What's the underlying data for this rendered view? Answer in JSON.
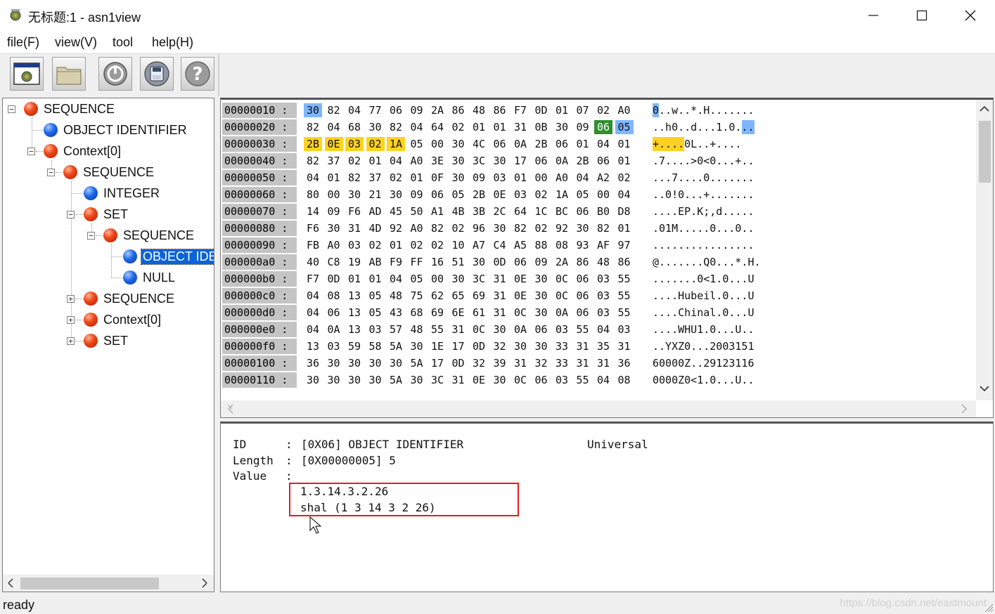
{
  "window": {
    "title": "无标题:1 - asn1view"
  },
  "menu": [
    "file(F)",
    "view(V)",
    "tool",
    "help(H)"
  ],
  "toolbar": {
    "buttons": [
      "app-icon",
      "folder-icon",
      "power-icon",
      "disk-icon",
      "help-icon"
    ]
  },
  "tree": {
    "nodes": [
      {
        "label": "SEQUENCE",
        "color": "red"
      },
      {
        "label": "OBJECT IDENTIFIER",
        "color": "blue"
      },
      {
        "label": "Context[0]",
        "color": "red"
      },
      {
        "label": "SEQUENCE",
        "color": "red"
      },
      {
        "label": "INTEGER",
        "color": "blue"
      },
      {
        "label": "SET",
        "color": "red"
      },
      {
        "label": "SEQUENCE",
        "color": "red"
      },
      {
        "label": "OBJECT IDENTIFIER",
        "color": "blue",
        "selected": true
      },
      {
        "label": "NULL",
        "color": "blue"
      },
      {
        "label": "SEQUENCE",
        "color": "red"
      },
      {
        "label": "Context[0]",
        "color": "red"
      },
      {
        "label": "SET",
        "color": "red"
      }
    ]
  },
  "hex": {
    "rows": [
      {
        "offset": "00000010 :",
        "bytes": [
          "30",
          "82",
          "04",
          "77",
          "06",
          "09",
          "2A",
          "86",
          "48",
          "86",
          "F7",
          "0D",
          "01",
          "07",
          "02",
          "A0"
        ],
        "ascii": "0..w..*.H.......",
        "hl": {
          "0": "blue"
        },
        "ascii_hl": [
          [
            0,
            1,
            "blue"
          ]
        ]
      },
      {
        "offset": "00000020 :",
        "bytes": [
          "82",
          "04",
          "68",
          "30",
          "82",
          "04",
          "64",
          "02",
          "01",
          "01",
          "31",
          "0B",
          "30",
          "09",
          "06",
          "05"
        ],
        "ascii": "..h0..d...1.0...",
        "hl": {
          "14": "green",
          "15": "blue"
        },
        "ascii_hl": [
          [
            14,
            16,
            "blue"
          ]
        ]
      },
      {
        "offset": "00000030 :",
        "bytes": [
          "2B",
          "0E",
          "03",
          "02",
          "1A",
          "05",
          "00",
          "30",
          "4C",
          "06",
          "0A",
          "2B",
          "06",
          "01",
          "04",
          "01"
        ],
        "ascii": "+....0L..+....",
        "hl": {
          "0": "yellow",
          "1": "yellow",
          "2": "yellow",
          "3": "yellow",
          "4": "yellow"
        },
        "ascii_hl": [
          [
            0,
            5,
            "yellow"
          ]
        ]
      },
      {
        "offset": "00000040 :",
        "bytes": [
          "82",
          "37",
          "02",
          "01",
          "04",
          "A0",
          "3E",
          "30",
          "3C",
          "30",
          "17",
          "06",
          "0A",
          "2B",
          "06",
          "01"
        ],
        "ascii": ".7....>0<0...+..",
        "hl": {},
        "ascii_hl": []
      },
      {
        "offset": "00000050 :",
        "bytes": [
          "04",
          "01",
          "82",
          "37",
          "02",
          "01",
          "0F",
          "30",
          "09",
          "03",
          "01",
          "00",
          "A0",
          "04",
          "A2",
          "02"
        ],
        "ascii": "...7....0.......",
        "hl": {},
        "ascii_hl": []
      },
      {
        "offset": "00000060 :",
        "bytes": [
          "80",
          "00",
          "30",
          "21",
          "30",
          "09",
          "06",
          "05",
          "2B",
          "0E",
          "03",
          "02",
          "1A",
          "05",
          "00",
          "04"
        ],
        "ascii": "..0!0...+.......",
        "hl": {},
        "ascii_hl": []
      },
      {
        "offset": "00000070 :",
        "bytes": [
          "14",
          "09",
          "F6",
          "AD",
          "45",
          "50",
          "A1",
          "4B",
          "3B",
          "2C",
          "64",
          "1C",
          "BC",
          "06",
          "B0",
          "D8"
        ],
        "ascii": "....EP.K;,d.....",
        "hl": {},
        "ascii_hl": []
      },
      {
        "offset": "00000080 :",
        "bytes": [
          "F6",
          "30",
          "31",
          "4D",
          "92",
          "A0",
          "82",
          "02",
          "96",
          "30",
          "82",
          "02",
          "92",
          "30",
          "82",
          "01"
        ],
        "ascii": ".01M.....0...0..",
        "hl": {},
        "ascii_hl": []
      },
      {
        "offset": "00000090 :",
        "bytes": [
          "FB",
          "A0",
          "03",
          "02",
          "01",
          "02",
          "02",
          "10",
          "A7",
          "C4",
          "A5",
          "88",
          "08",
          "93",
          "AF",
          "97"
        ],
        "ascii": "................",
        "hl": {},
        "ascii_hl": []
      },
      {
        "offset": "000000a0 :",
        "bytes": [
          "40",
          "C8",
          "19",
          "AB",
          "F9",
          "FF",
          "16",
          "51",
          "30",
          "0D",
          "06",
          "09",
          "2A",
          "86",
          "48",
          "86"
        ],
        "ascii": "@.......Q0...*.H.",
        "hl": {},
        "ascii_hl": []
      },
      {
        "offset": "000000b0 :",
        "bytes": [
          "F7",
          "0D",
          "01",
          "01",
          "04",
          "05",
          "00",
          "30",
          "3C",
          "31",
          "0E",
          "30",
          "0C",
          "06",
          "03",
          "55"
        ],
        "ascii": ".......0<1.0...U",
        "hl": {},
        "ascii_hl": []
      },
      {
        "offset": "000000c0 :",
        "bytes": [
          "04",
          "08",
          "13",
          "05",
          "48",
          "75",
          "62",
          "65",
          "69",
          "31",
          "0E",
          "30",
          "0C",
          "06",
          "03",
          "55"
        ],
        "ascii": "....Hubeil.0...U",
        "hl": {},
        "ascii_hl": []
      },
      {
        "offset": "000000d0 :",
        "bytes": [
          "04",
          "06",
          "13",
          "05",
          "43",
          "68",
          "69",
          "6E",
          "61",
          "31",
          "0C",
          "30",
          "0A",
          "06",
          "03",
          "55"
        ],
        "ascii": "....Chinal.0...U",
        "hl": {},
        "ascii_hl": []
      },
      {
        "offset": "000000e0 :",
        "bytes": [
          "04",
          "0A",
          "13",
          "03",
          "57",
          "48",
          "55",
          "31",
          "0C",
          "30",
          "0A",
          "06",
          "03",
          "55",
          "04",
          "03"
        ],
        "ascii": "....WHU1.0...U..",
        "hl": {},
        "ascii_hl": []
      },
      {
        "offset": "000000f0 :",
        "bytes": [
          "13",
          "03",
          "59",
          "58",
          "5A",
          "30",
          "1E",
          "17",
          "0D",
          "32",
          "30",
          "30",
          "33",
          "31",
          "35",
          "31"
        ],
        "ascii": "..YXZ0...2003151",
        "hl": {},
        "ascii_hl": []
      },
      {
        "offset": "00000100 :",
        "bytes": [
          "36",
          "30",
          "30",
          "30",
          "30",
          "5A",
          "17",
          "0D",
          "32",
          "39",
          "31",
          "32",
          "33",
          "31",
          "31",
          "36"
        ],
        "ascii": "60000Z..29123116",
        "hl": {},
        "ascii_hl": []
      },
      {
        "offset": "00000110 :",
        "bytes": [
          "30",
          "30",
          "30",
          "30",
          "5A",
          "30",
          "3C",
          "31",
          "0E",
          "30",
          "0C",
          "06",
          "03",
          "55",
          "04",
          "08"
        ],
        "ascii": "0000Z0<1.0...U..",
        "hl": {},
        "ascii_hl": []
      }
    ]
  },
  "info": {
    "id_label": "ID",
    "id_sep": ":",
    "id_value": "[0X06] OBJECT IDENTIFIER",
    "class": "Universal",
    "length_label": "Length",
    "length_sep": ":",
    "length_value": "[0X00000005] 5",
    "value_label": "Value",
    "value_sep": ":",
    "value_lines": [
      "1.3.14.3.2.26",
      "shal (1 3 14 3 2 26)"
    ]
  },
  "status": {
    "text": "ready",
    "watermark": "https://blog.csdn.net/eastmount"
  },
  "colors": {
    "highlight_blue": "#7fb6ff",
    "highlight_green": "#2f8f2f",
    "highlight_yellow": "#ffd21f",
    "selection": "#0a63d8",
    "callout_red": "#e02020"
  }
}
